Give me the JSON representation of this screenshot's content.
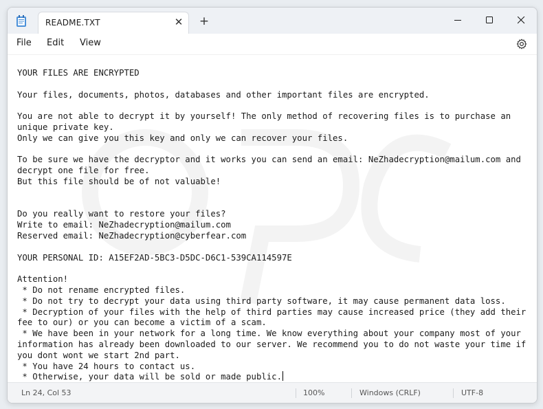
{
  "window": {
    "tab_title": "README.TXT",
    "new_tab_symbol": "+"
  },
  "menu": {
    "file": "File",
    "edit": "Edit",
    "view": "View"
  },
  "document": {
    "lines": [
      "YOUR FILES ARE ENCRYPTED",
      "",
      "Your files, documents, photos, databases and other important files are encrypted.",
      "",
      "You are not able to decrypt it by yourself! The only method of recovering files is to purchase an",
      "unique private key.",
      "Only we can give you this key and only we can recover your files.",
      "",
      "To be sure we have the decryptor and it works you can send an email: NeZhadecryption@mailum.com and",
      "decrypt one file for free.",
      "But this file should be of not valuable!",
      "",
      "",
      "Do you really want to restore your files?",
      "Write to email: NeZhadecryption@mailum.com",
      "Reserved email: NeZhadecryption@cyberfear.com",
      "",
      "YOUR PERSONAL ID: A15EF2AD-5BC3-D5DC-D6C1-539CA114597E",
      "",
      "Attention!",
      " * Do not rename encrypted files.",
      " * Do not try to decrypt your data using third party software, it may cause permanent data loss.",
      " * Decryption of your files with the help of third parties may cause increased price (they add their",
      "fee to our) or you can become a victim of a scam.",
      " * We have been in your network for a long time. We know everything about your company most of your",
      "information has already been downloaded to our server. We recommend you to do not waste your time if",
      "you dont wont we start 2nd part.",
      " * You have 24 hours to contact us.",
      " * Otherwise, your data will be sold or made public."
    ]
  },
  "status": {
    "position": "Ln 24, Col 53",
    "zoom": "100%",
    "line_ending": "Windows (CRLF)",
    "encoding": "UTF-8"
  },
  "icons": {
    "app": "notepad-icon",
    "close_tab": "close-icon",
    "minimize": "minimize-icon",
    "maximize": "maximize-icon",
    "close_window": "close-icon",
    "settings": "gear-icon"
  },
  "colors": {
    "titlebar": "#eef1f5",
    "editor_bg": "#ffffff",
    "statusbar": "#f3f4f6",
    "text": "#1a1a1a"
  }
}
